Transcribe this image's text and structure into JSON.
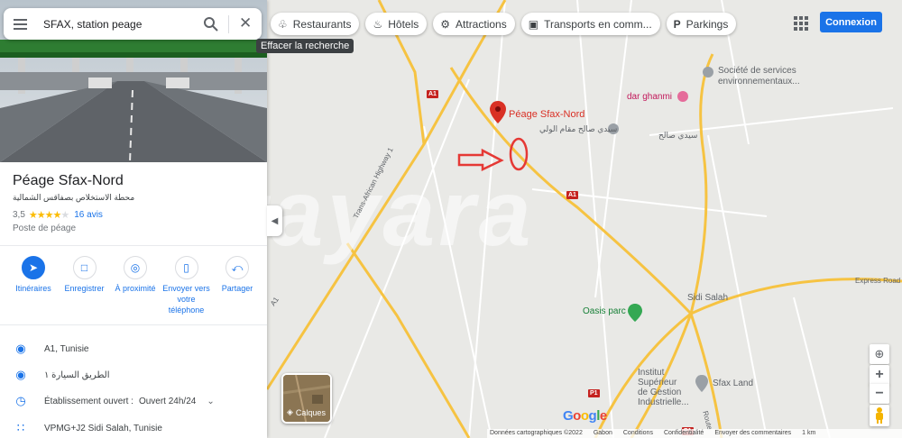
{
  "search": {
    "value": "SFAX, station peage",
    "tooltip": "Effacer la recherche"
  },
  "chips": [
    {
      "icon": "restaurant-icon",
      "glyph": "♧",
      "label": "Restaurants"
    },
    {
      "icon": "hotel-icon",
      "glyph": "♨",
      "label": "Hôtels"
    },
    {
      "icon": "attractions-icon",
      "glyph": "⚙",
      "label": "Attractions"
    },
    {
      "icon": "transit-icon",
      "glyph": "▣",
      "label": "Transports en comm..."
    },
    {
      "icon": "parking-icon",
      "glyph": "P",
      "label": "Parkings"
    }
  ],
  "header": {
    "connexion_label": "Connexion"
  },
  "place": {
    "title": "Péage Sfax-Nord",
    "subtitle_ar": "محطة الاستخلاص بصفاقس الشمالية",
    "rating": "3,5",
    "stars": 3.5,
    "reviews": "16 avis",
    "category": "Poste de péage"
  },
  "actions": [
    {
      "icon": "directions-icon",
      "label": "Itinéraires",
      "primary": true
    },
    {
      "icon": "bookmark-icon",
      "label": "Enregistrer"
    },
    {
      "icon": "nearby-icon",
      "label": "À proximité"
    },
    {
      "icon": "send-to-phone-icon",
      "label": "Envoyer vers votre téléphone"
    },
    {
      "icon": "share-icon",
      "label": "Partager"
    }
  ],
  "info": {
    "address": "A1, Tunisie",
    "address_ar": "الطريق السيارة ١",
    "hours_status": "Établissement ouvert :",
    "hours_value": "Ouvert 24h/24",
    "plus_code": "VPMG+J2 Sidi Salah, Tunisie"
  },
  "map": {
    "marker_label": "Péage Sfax-Nord",
    "labels": {
      "societe_line1": "Société de services",
      "societe_line2": "environnementaux...",
      "dar_ghanmi": "dar ghanmi",
      "mosque_ar": "سيدي صالح مقام الولي",
      "sidi_salah_ar": "سيدي صالح",
      "trans_african": "Trans-African Highway 1",
      "express_road": "Express Road",
      "sidi_salah": "Sidi Salah",
      "oasis_parc": "Oasis parc",
      "institut_1": "Institut",
      "institut_2": "Supérieur",
      "institut_3": "de Gestion",
      "institut_4": "Industrielle...",
      "sfax_land": "Sfax Land",
      "a1_left": "A1",
      "route_rte": "Route"
    },
    "shields": [
      "A1",
      "A1",
      "P1",
      "P1"
    ],
    "layers_label": "Calques",
    "google_letters": [
      "G",
      "o",
      "o",
      "g",
      "l",
      "e"
    ],
    "google_colors": [
      "#4285f4",
      "#ea4335",
      "#fbbc04",
      "#4285f4",
      "#34a853",
      "#ea4335"
    ],
    "watermark": "tayara",
    "footer": [
      "Données cartographiques ©2022",
      "Gabon",
      "Conditions",
      "Confidentialité",
      "Envoyer des commentaires",
      "1 km"
    ]
  },
  "colors": {
    "accent": "#1a73e8",
    "road": "#f6c342",
    "marker": "#d93025",
    "annotation": "#e53935"
  }
}
